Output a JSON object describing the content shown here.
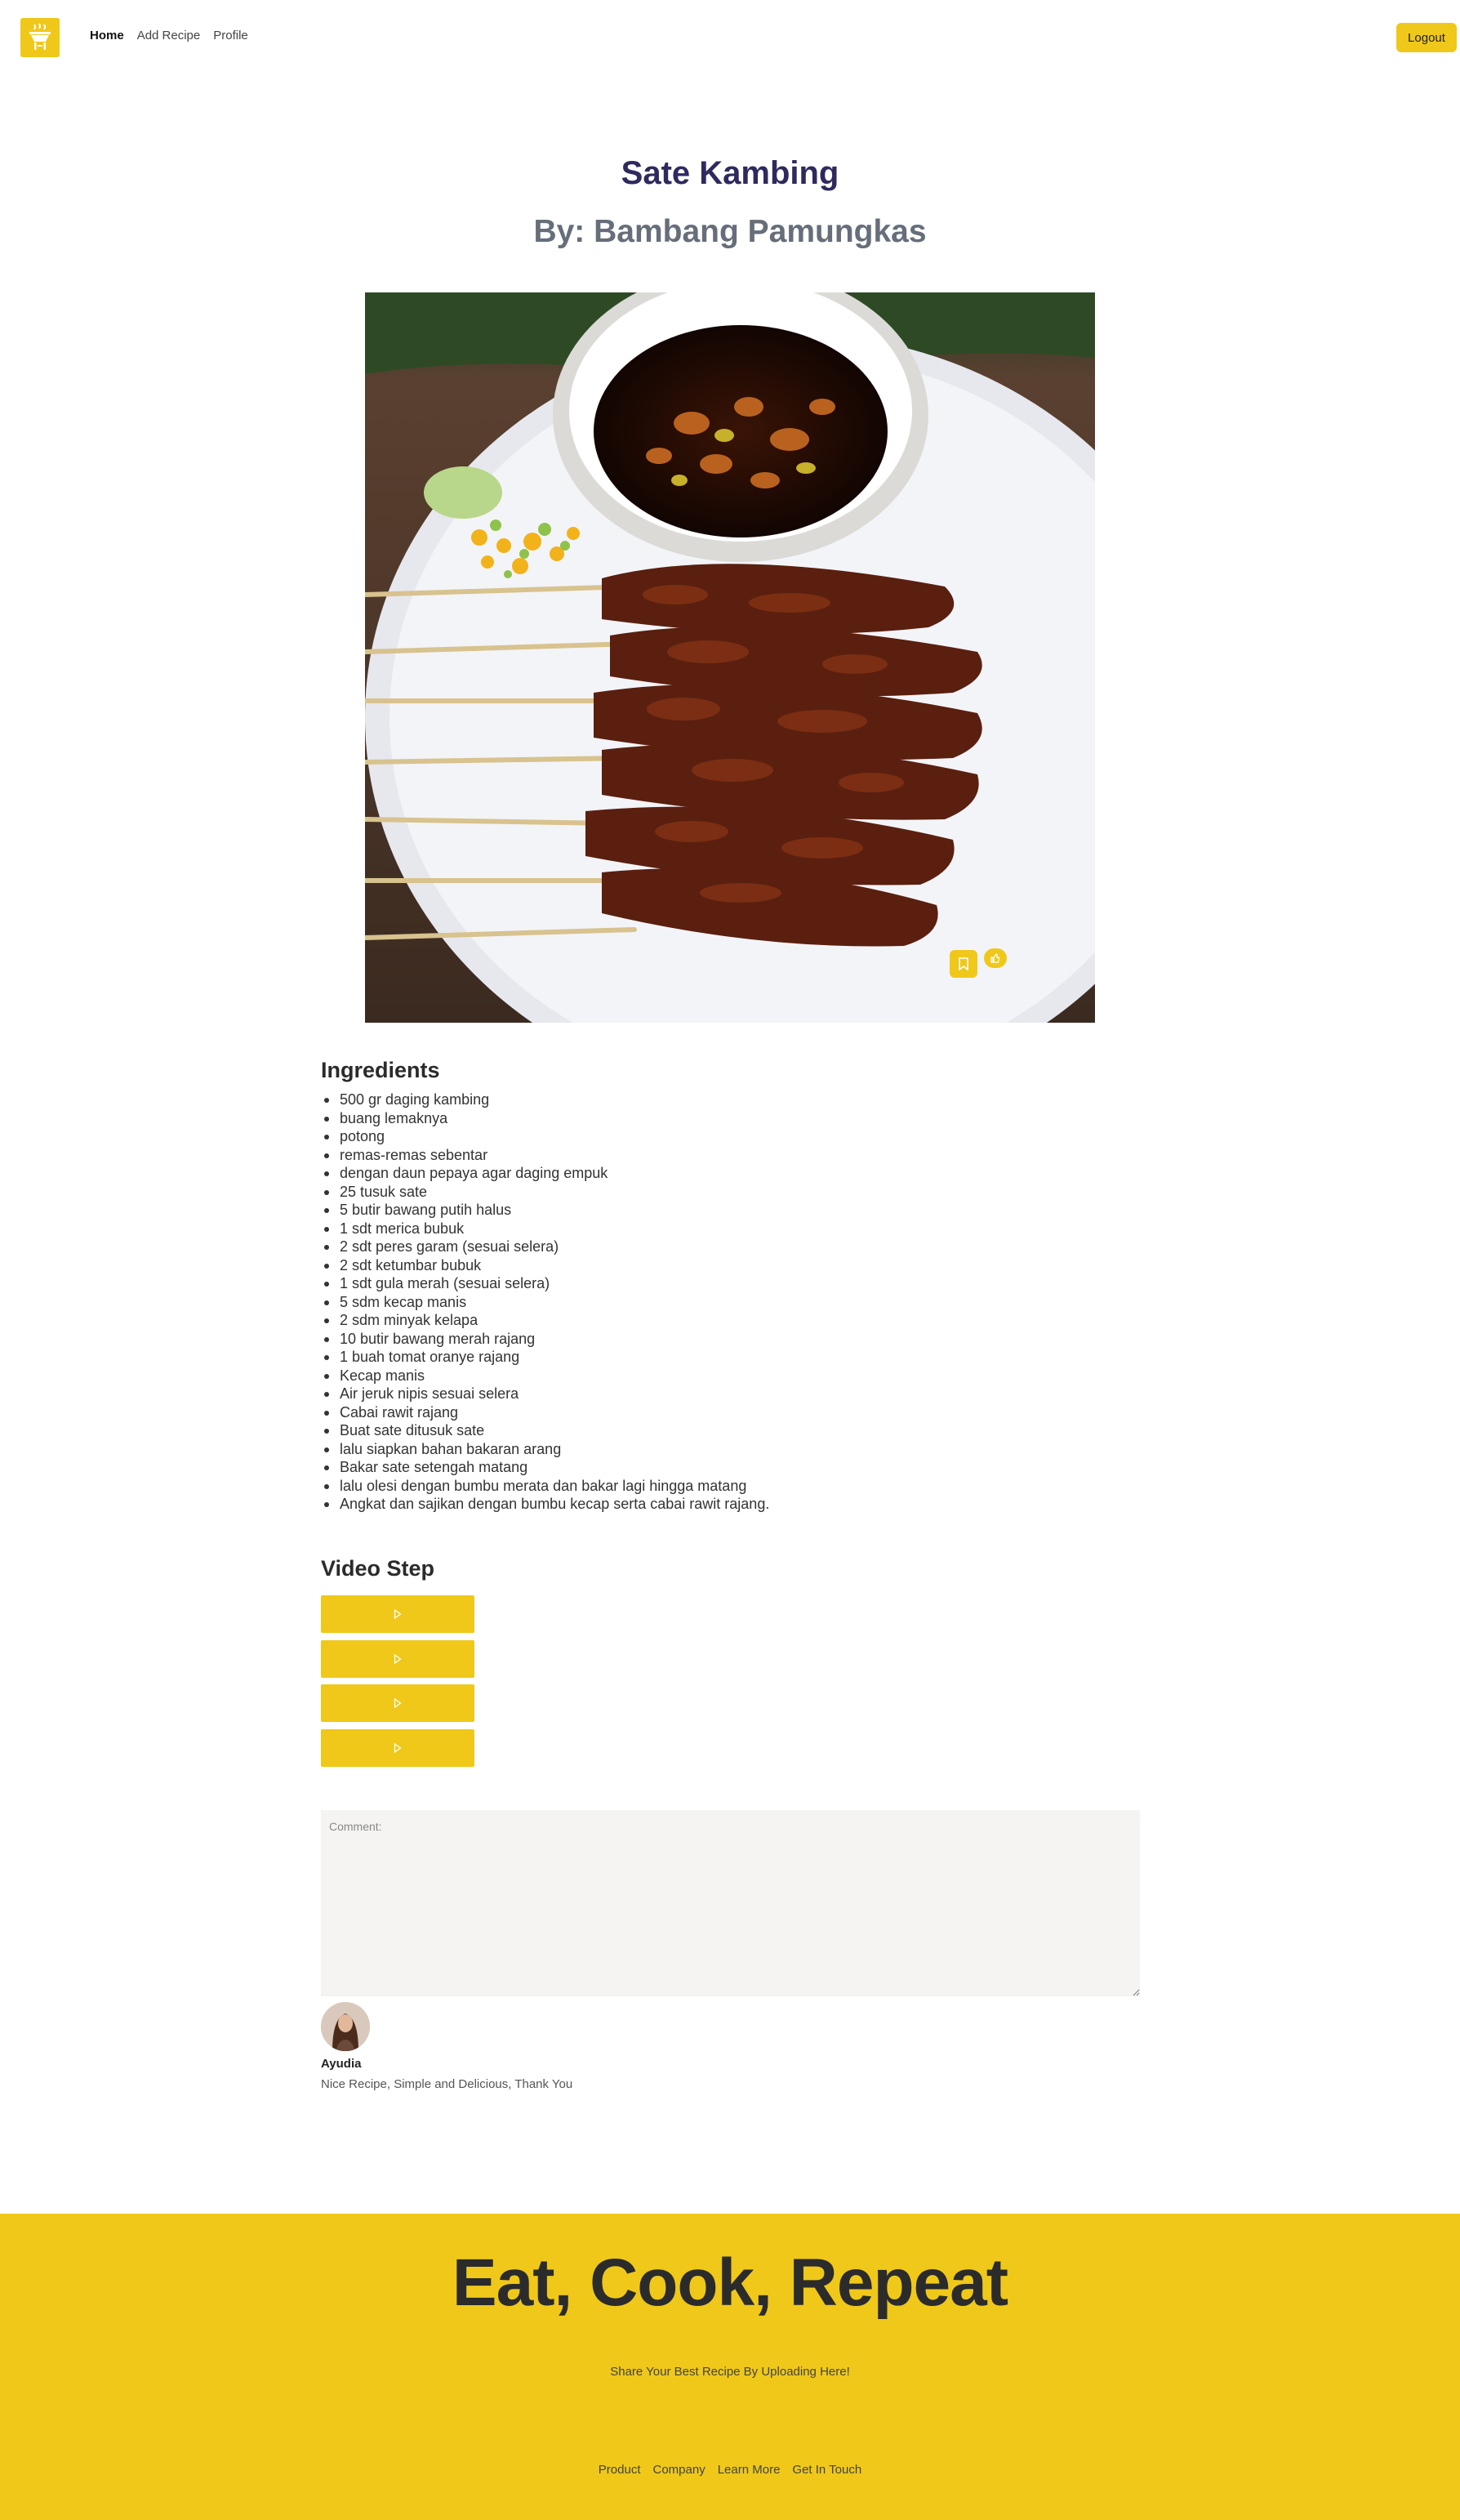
{
  "nav": {
    "links": [
      "Home",
      "Add Recipe",
      "Profile"
    ],
    "logout_label": "Logout",
    "brand_color": "#efc81a"
  },
  "recipe": {
    "title": "Sate Kambing",
    "author": "By: Bambang Pamungkas"
  },
  "ingredients": {
    "heading": "Ingredients",
    "items": [
      "500 gr daging kambing",
      "buang lemaknya",
      "potong",
      "remas-remas sebentar",
      "dengan daun pepaya agar daging empuk",
      "25 tusuk sate",
      "5 butir bawang putih halus",
      "1 sdt merica bubuk",
      "2 sdt peres garam (sesuai selera)",
      "2 sdt ketumbar bubuk",
      "1 sdt gula merah (sesuai selera)",
      "5 sdm kecap manis",
      "2 sdm minyak kelapa",
      "10 butir bawang merah rajang",
      "1 buah tomat oranye rajang",
      "Kecap manis",
      "Air jeruk nipis sesuai selera",
      "Cabai rawit rajang",
      "Buat sate ditusuk sate",
      "lalu siapkan bahan bakaran arang",
      "Bakar sate setengah matang",
      "lalu olesi dengan bumbu merata dan bakar lagi hingga matang",
      "Angkat dan sajikan dengan bumbu kecap serta cabai rawit rajang."
    ]
  },
  "video": {
    "heading": "Video Step",
    "count": 4,
    "icon": "play-icon"
  },
  "comment": {
    "placeholder": "Comment:",
    "items": [
      {
        "name": "Ayudia",
        "text": "Nice Recipe, Simple and Delicious, Thank You"
      }
    ]
  },
  "footer": {
    "title": "Eat, Cook, Repeat",
    "tagline": "Share Your Best Recipe By Uploading Here!",
    "links": [
      "Product",
      "Company",
      "Learn More",
      "Get In Touch"
    ]
  }
}
